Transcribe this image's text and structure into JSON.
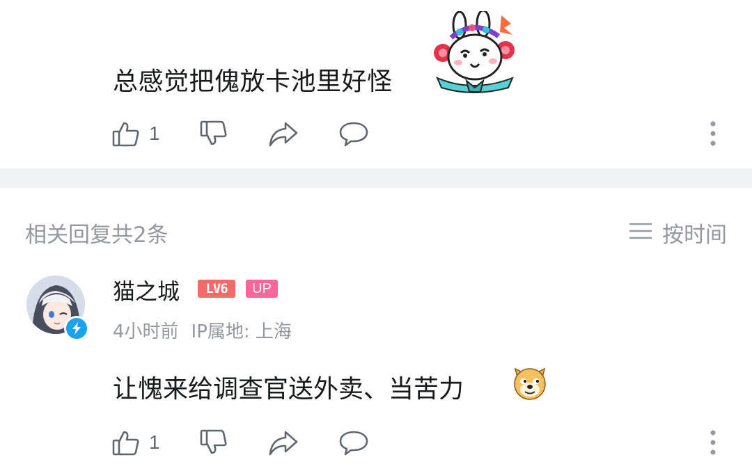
{
  "top_comment": {
    "text": "总感觉把傀放卡池里好怪",
    "sticker": "rabbit-opera-sticker",
    "actions": {
      "like_icon": "thumbs-up-icon",
      "like_count": "1",
      "dislike_icon": "thumbs-down-icon",
      "share_icon": "share-icon",
      "reply_icon": "comment-icon",
      "more_icon": "more-vertical-icon"
    }
  },
  "replies_section": {
    "header": "相关回复共2条",
    "sort_icon": "menu-lines-icon",
    "sort_label": "按时间"
  },
  "reply": {
    "username": "猫之城",
    "level": "LV6",
    "up_badge": "UP",
    "time": "4小时前",
    "ip": "IP属地: 上海",
    "text": "让愧来给调查官送外卖、当苦力",
    "emoji": "doge-emoji",
    "actions": {
      "like_count": "1"
    }
  },
  "colors": {
    "text": "#18191c",
    "secondary": "#9499a0",
    "divider": "#f1f2f3",
    "level_badge": "#f26a6a",
    "up_badge": "#ff6699",
    "verified": "#1aa3ed"
  }
}
